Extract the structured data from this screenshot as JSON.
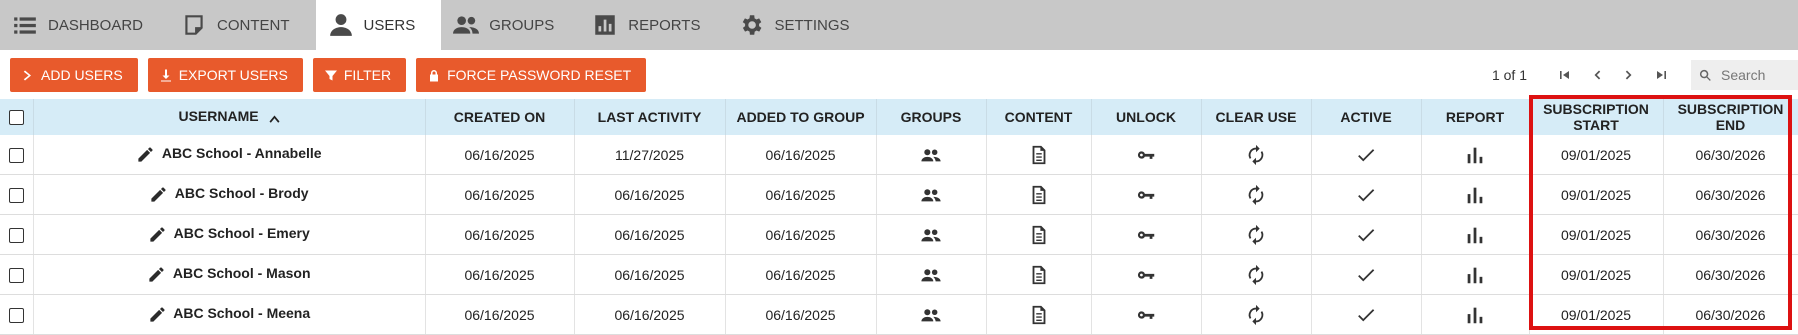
{
  "nav": {
    "items": [
      {
        "label": "DASHBOARD",
        "icon": "list-icon"
      },
      {
        "label": "CONTENT",
        "icon": "note-icon"
      },
      {
        "label": "USERS",
        "icon": "person-icon"
      },
      {
        "label": "GROUPS",
        "icon": "people-icon"
      },
      {
        "label": "REPORTS",
        "icon": "bar-chart-icon"
      },
      {
        "label": "SETTINGS",
        "icon": "gear-icon"
      }
    ],
    "active": "USERS"
  },
  "toolbar": {
    "add_users": "ADD USERS",
    "export_users": "EXPORT USERS",
    "filter": "FILTER",
    "force_password_reset": "FORCE PASSWORD RESET"
  },
  "pager": {
    "info": "1 of 1"
  },
  "search": {
    "placeholder": "Search"
  },
  "table": {
    "headers": {
      "username": "USERNAME",
      "created_on": "CREATED ON",
      "last_activity": "LAST ACTIVITY",
      "added_to_group": "ADDED TO GROUP",
      "groups": "GROUPS",
      "content": "CONTENT",
      "unlock": "UNLOCK",
      "clear_use": "CLEAR USE",
      "active": "ACTIVE",
      "report": "REPORT",
      "subscription_start_line1": "SUBSCRIPTION",
      "subscription_start_line2": "START",
      "subscription_end_line1": "SUBSCRIPTION",
      "subscription_end_line2": "END"
    },
    "rows": [
      {
        "username": "ABC School - Annabelle",
        "created_on": "06/16/2025",
        "last_activity": "11/27/2025",
        "added_to_group": "06/16/2025",
        "subscription_start": "09/01/2025",
        "subscription_end": "06/30/2026"
      },
      {
        "username": "ABC School - Brody",
        "created_on": "06/16/2025",
        "last_activity": "06/16/2025",
        "added_to_group": "06/16/2025",
        "subscription_start": "09/01/2025",
        "subscription_end": "06/30/2026"
      },
      {
        "username": "ABC School - Emery",
        "created_on": "06/16/2025",
        "last_activity": "06/16/2025",
        "added_to_group": "06/16/2025",
        "subscription_start": "09/01/2025",
        "subscription_end": "06/30/2026"
      },
      {
        "username": "ABC School - Mason",
        "created_on": "06/16/2025",
        "last_activity": "06/16/2025",
        "added_to_group": "06/16/2025",
        "subscription_start": "09/01/2025",
        "subscription_end": "06/30/2026"
      },
      {
        "username": "ABC School - Meena",
        "created_on": "06/16/2025",
        "last_activity": "06/16/2025",
        "added_to_group": "06/16/2025",
        "subscription_start": "09/01/2025",
        "subscription_end": "06/30/2026"
      }
    ]
  },
  "colors": {
    "accent": "#e85a2c",
    "header_bg": "#d6ecf7",
    "nav_bg": "#c8c8c8",
    "highlight": "#dd1111"
  }
}
